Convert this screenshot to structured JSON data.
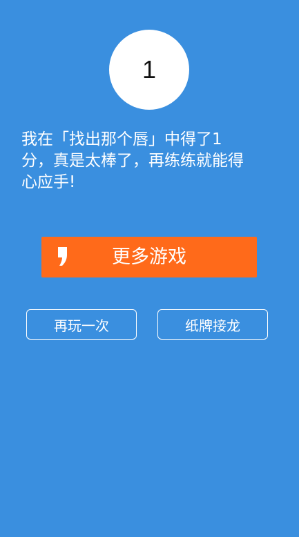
{
  "score": {
    "value": "1"
  },
  "message": {
    "text": "我在「找出那个唇」中得了1\n分，真是太棒了，再练练就能得\n心应手!"
  },
  "buttons": {
    "more_games": "更多游戏",
    "replay": "再玩一次",
    "solitaire": "纸牌接龙"
  },
  "colors": {
    "background": "#3a8fdf",
    "accent": "#ff6a1a",
    "text": "#ffffff"
  },
  "icons": {
    "more_games_icon": "comma-logo-icon"
  }
}
